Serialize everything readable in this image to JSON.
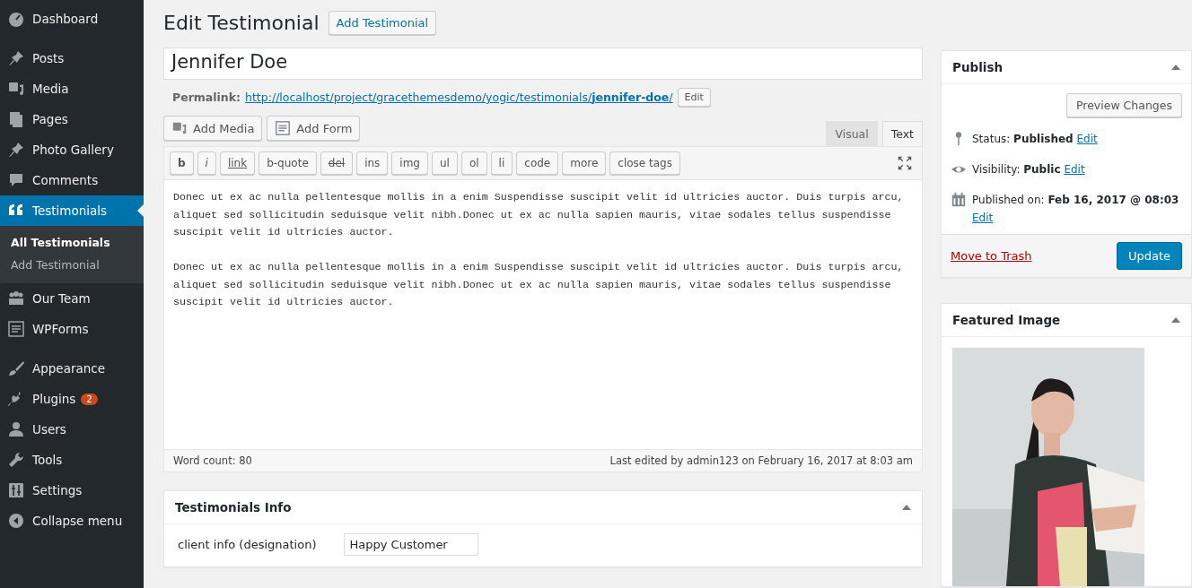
{
  "sidebar": {
    "groups": [
      [
        {
          "label": "Dashboard",
          "selected": false
        }
      ],
      [
        {
          "label": "Posts",
          "selected": false
        },
        {
          "label": "Media",
          "selected": false
        },
        {
          "label": "Pages",
          "selected": false
        },
        {
          "label": "Photo Gallery",
          "selected": false
        },
        {
          "label": "Comments",
          "selected": false
        },
        {
          "label": "Testimonials",
          "selected": true,
          "children": [
            {
              "label": "All Testimonials",
              "selected": true
            },
            {
              "label": "Add Testimonial",
              "selected": false
            }
          ]
        },
        {
          "label": "Our Team",
          "selected": false
        },
        {
          "label": "WPForms",
          "selected": false
        }
      ],
      [
        {
          "label": "Appearance",
          "selected": false
        },
        {
          "label": "Plugins",
          "selected": false,
          "badge": "2"
        },
        {
          "label": "Users",
          "selected": false
        },
        {
          "label": "Tools",
          "selected": false
        },
        {
          "label": "Settings",
          "selected": false
        },
        {
          "label": "Collapse menu",
          "selected": false
        }
      ]
    ]
  },
  "page": {
    "title": "Edit Testimonial",
    "action_button": "Add Testimonial"
  },
  "post_title": {
    "value": "Jennifer Doe"
  },
  "permalink": {
    "label": "Permalink:",
    "url": "http://localhost/project/gracethemesdemo/yogic/testimonials/**jennifer-doe**/",
    "button": "Edit"
  },
  "media_buttons": [
    "Add Media",
    "Add Form"
  ],
  "editor_tabs": [
    {
      "label": "Visual",
      "selected": false
    },
    {
      "label": "Text",
      "selected": true
    }
  ],
  "quicktags": [
    {
      "label": "b",
      "kind": "bold"
    },
    {
      "label": "i",
      "kind": "italic"
    },
    {
      "label": "link",
      "kind": "underline"
    },
    {
      "label": "b-quote",
      "kind": "plain"
    },
    {
      "label": "del",
      "kind": "strike"
    },
    {
      "label": "ins",
      "kind": "plain"
    },
    {
      "label": "img",
      "kind": "plain"
    },
    {
      "label": "ul",
      "kind": "plain"
    },
    {
      "label": "ol",
      "kind": "plain"
    },
    {
      "label": "li",
      "kind": "plain"
    },
    {
      "label": "code",
      "kind": "plain"
    },
    {
      "label": "more",
      "kind": "plain"
    },
    {
      "label": "close tags",
      "kind": "plain"
    }
  ],
  "content": [
    "Donec ut ex ac nulla pellentesque mollis in a enim Suspendisse suscipit velit id ultricies auctor. Duis turpis arcu, aliquet sed sollicitudin seduisque velit nibh.Donec ut ex ac nulla sapien mauris, vitae sodales tellus suspendisse suscipit velit id ultricies auctor.",
    "Donec ut ex ac nulla pellentesque mollis in a enim Suspendisse suscipit velit id ultricies auctor. Duis turpis arcu, aliquet sed sollicitudin seduisque velit nibh.Donec ut ex ac nulla sapien mauris, vitae sodales tellus suspendisse suscipit velit id ultricies auctor."
  ],
  "editor_footer": {
    "word_count": "Word count: 80",
    "last_edited": "Last edited by admin123 on February 16, 2017 at 8:03 am"
  },
  "testimonials_info": {
    "title": "Testimonials Info",
    "fields": [
      {
        "label": "client info (designation)",
        "value": "Happy Customer"
      }
    ]
  },
  "publish": {
    "title": "Publish",
    "preview_button": "Preview Changes",
    "rows": [
      {
        "kind": "status",
        "text": "Status: **Published**",
        "link": "Edit"
      },
      {
        "kind": "visibility",
        "text": "Visibility: **Public**",
        "link": "Edit"
      },
      {
        "kind": "date",
        "text": "Published on: **Feb 16, 2017 @ 08:03**",
        "link": "Edit"
      }
    ],
    "trash_link": "Move to Trash",
    "update_button": "Update"
  },
  "featured_image": {
    "title": "Featured Image"
  }
}
